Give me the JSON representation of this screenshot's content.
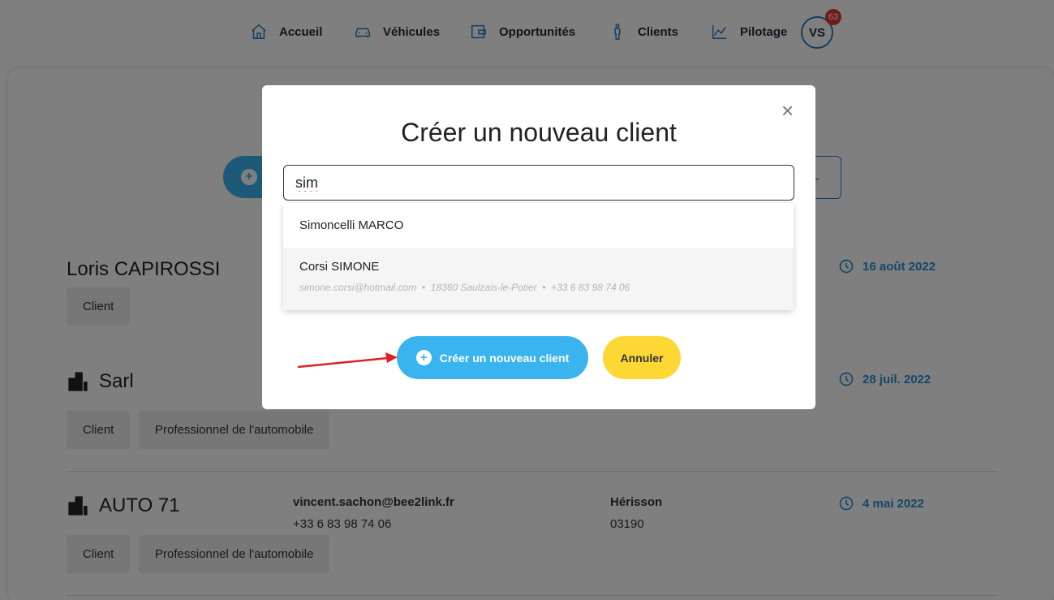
{
  "nav": {
    "items": [
      {
        "label": "Accueil",
        "icon": "home-icon"
      },
      {
        "label": "Véhicules",
        "icon": "car-icon"
      },
      {
        "label": "Opportunités",
        "icon": "wallet-icon"
      },
      {
        "label": "Clients",
        "icon": "person-icon"
      },
      {
        "label": "Pilotage",
        "icon": "chart-icon"
      }
    ],
    "avatar": "VS",
    "badge": "63"
  },
  "clients": [
    {
      "name": "Loris CAPIROSSI",
      "tags": [
        "Client"
      ],
      "date": "16 août 2022"
    },
    {
      "name": "Sarl",
      "tags": [
        "Client",
        "Professionnel de l'automobile"
      ],
      "date": "28 juil. 2022"
    },
    {
      "name": "AUTO 71",
      "tags": [
        "Client",
        "Professionnel de l'automobile"
      ],
      "email": "vincent.sachon@bee2link.fr",
      "phone": "+33 6 83 98 74 06",
      "city": "Hérisson",
      "zip": "03190",
      "date": "4 mai 2022"
    }
  ],
  "modal": {
    "title": "Créer un nouveau client",
    "search_value": "sim",
    "suggestions": [
      {
        "name": "Simoncelli MARCO"
      },
      {
        "name": "Corsi SIMONE",
        "email": "simone.corsi@hotmail.com",
        "address": "18360 Saulzais-le-Potier",
        "phone": "+33 6 83 98 74 06"
      }
    ],
    "create_label": "Créer un nouveau client",
    "cancel_label": "Annuler",
    "close": "×"
  },
  "colors": {
    "accent": "#39b4ef",
    "yellow": "#fdd835",
    "nav_icon": "#2a7bbf",
    "badge": "#e53935",
    "date": "#2a8fd0"
  }
}
